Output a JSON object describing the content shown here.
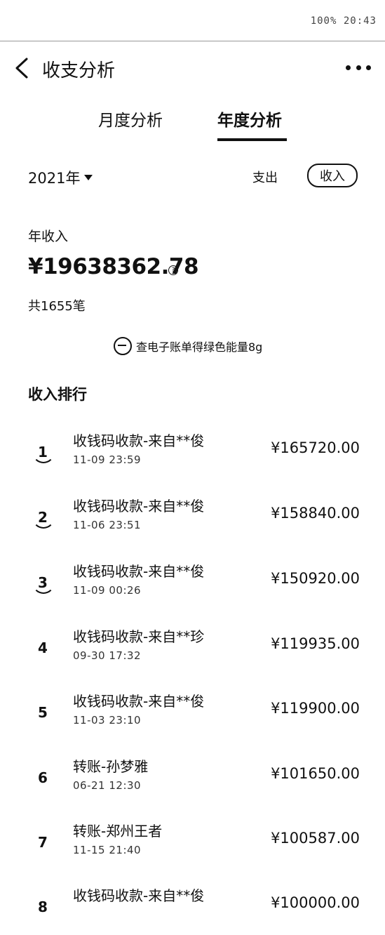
{
  "status_bar": {
    "right_text": "100% 20:43"
  },
  "header": {
    "title": "收支分析"
  },
  "tabs": [
    {
      "label": "月度分析"
    },
    {
      "label": "年度分析"
    }
  ],
  "filter": {
    "year": "2021年",
    "expense_label": "支出",
    "income_label": "收入"
  },
  "summary": {
    "label": "年收入",
    "amount": "¥19638362.78",
    "help_icon": "?",
    "count": "共1655笔"
  },
  "ebill": {
    "text": "查电子账单得绿色能量8g"
  },
  "ranking": {
    "title": "收入排行",
    "rows": [
      {
        "rank": "1",
        "name": "收钱码收款-来自**俊",
        "time": "11-09 23:59",
        "amount": "¥165720.00"
      },
      {
        "rank": "2",
        "name": "收钱码收款-来自**俊",
        "time": "11-06 23:51",
        "amount": "¥158840.00"
      },
      {
        "rank": "3",
        "name": "收钱码收款-来自**俊",
        "time": "11-09 00:26",
        "amount": "¥150920.00"
      },
      {
        "rank": "4",
        "name": "收钱码收款-来自**珍",
        "time": "09-30 17:32",
        "amount": "¥119935.00"
      },
      {
        "rank": "5",
        "name": "收钱码收款-来自**俊",
        "time": "11-03 23:10",
        "amount": "¥119900.00"
      },
      {
        "rank": "6",
        "name": "转账-孙梦雅",
        "time": "06-21 12:30",
        "amount": "¥101650.00"
      },
      {
        "rank": "7",
        "name": "转账-郑州王者",
        "time": "11-15 21:40",
        "amount": "¥100587.00"
      },
      {
        "rank": "8",
        "name": "收钱码收款-来自**俊",
        "time": "",
        "amount": "¥100000.00"
      }
    ]
  }
}
